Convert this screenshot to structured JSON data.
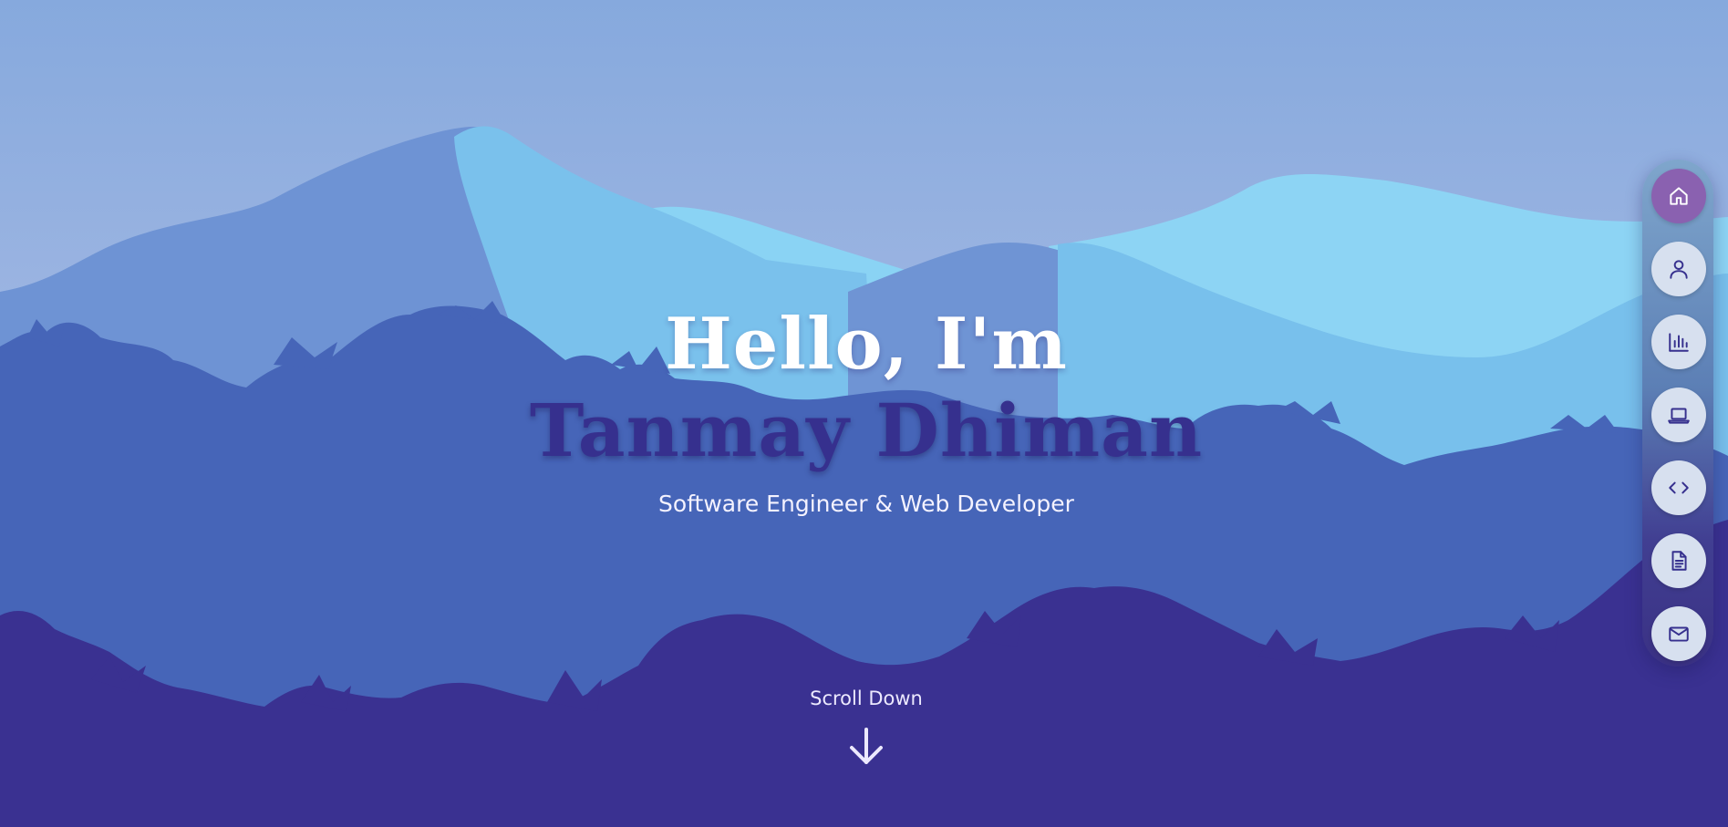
{
  "hero": {
    "greeting": "Hello, I'm",
    "name": "Tanmay Dhiman",
    "tagline": "Software Engineer & Web Developer"
  },
  "scroll": {
    "label": "Scroll Down",
    "icon": "arrow-down-icon"
  },
  "side_nav": {
    "items": [
      {
        "icon": "home-icon",
        "active": true
      },
      {
        "icon": "user-icon",
        "active": false
      },
      {
        "icon": "bar-chart-icon",
        "active": false
      },
      {
        "icon": "laptop-icon",
        "active": false
      },
      {
        "icon": "code-icon",
        "active": false
      },
      {
        "icon": "document-icon",
        "active": false
      },
      {
        "icon": "mail-icon",
        "active": false
      }
    ]
  },
  "colors": {
    "sky": "#8aaddf",
    "mountain_back": "#6d91d3",
    "mountain_light": "#82cbf0",
    "forest_mid": "#4665b8",
    "forest_front": "#3a3191",
    "name_text": "#36308e",
    "nav_active": "#8a61b0",
    "nav_button": "#d7e0ef"
  }
}
